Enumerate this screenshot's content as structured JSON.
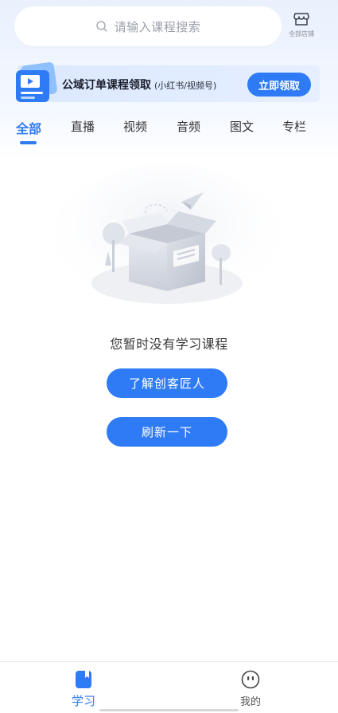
{
  "search": {
    "placeholder": "请输入课程搜索"
  },
  "store": {
    "label": "全部店铺"
  },
  "banner": {
    "title": "公域订单课程领取",
    "subtitle": "(小红书/视频号)",
    "claim_label": "立即领取"
  },
  "tabs": [
    {
      "label": "全部",
      "active": true
    },
    {
      "label": "直播",
      "active": false
    },
    {
      "label": "视频",
      "active": false
    },
    {
      "label": "音频",
      "active": false
    },
    {
      "label": "图文",
      "active": false
    },
    {
      "label": "专栏",
      "active": false
    }
  ],
  "empty_state": {
    "message": "您暂时没有学习课程",
    "learn_button": "了解创客匠人",
    "refresh_button": "刷新一下"
  },
  "bottom_nav": {
    "items": [
      {
        "label": "学习",
        "icon": "book-icon",
        "active": true
      },
      {
        "label": "我的",
        "icon": "face-icon",
        "active": false
      }
    ]
  },
  "colors": {
    "accent": "#2f7bf6",
    "banner_bg": "#dfeaff",
    "header_bg": "#eaf1fd"
  }
}
